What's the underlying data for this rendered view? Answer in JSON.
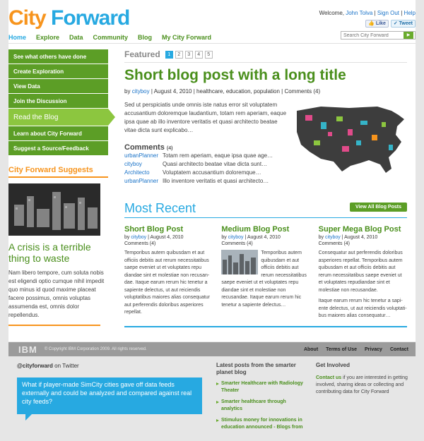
{
  "header": {
    "logo_part1": "City",
    "logo_part2": " Forward",
    "welcome": "Welcome,",
    "user": "John Tolva",
    "sign_out": "Sign Out",
    "help": "Help",
    "like": "Like",
    "tweet": "Tweet",
    "search_placeholder": "Search City Forward"
  },
  "nav": [
    "Home",
    "Explore",
    "Data",
    "Community",
    "Blog",
    "My City Forward"
  ],
  "sidebar": {
    "items": [
      "See what others have done",
      "Create Exploration",
      "View Data",
      "Join the Discussion",
      "Read the Blog",
      "Learn about City Forward",
      "Suggest a Source/Feedback"
    ],
    "suggests_heading": "City Forward Suggests",
    "crisis_title": "A crisis is a terrible thing to waste",
    "suggest_text": "Nam libero tempore, cum soluta nobis est eligendi optio cumque nihil impedit quo minus id quod maxime placeat facere possimus, omnis voluptas assumenda est, omnis dolor repellendus."
  },
  "featured": {
    "label": "Featured",
    "pages": [
      "1",
      "2",
      "3",
      "4",
      "5"
    ],
    "title": "Short blog post with a long title",
    "by": "by",
    "author": "cityboy",
    "date": "August 4, 2010",
    "tags": "healthcare, education, population",
    "comments_link": "Comments (4)",
    "excerpt": "Sed ut perspiciatis unde omnis iste natus error sit voluptatem accusantium doloremque laudantium, totam rem aperiam, eaque ipsa quae ab illo inventore veritatis et quasi architecto beatae vitae dicta sunt explicabo…",
    "comments_heading": "Comments",
    "comments_count": "(4)",
    "comments": [
      {
        "user": "urbanPlanner",
        "text": "Totam rem aperiam, eaque ipsa quae age…"
      },
      {
        "user": "cityboy",
        "text": "Quasi architecto beatae vitae dicta sunt…"
      },
      {
        "user": "Architecto",
        "text": "Voluptatem accusantium doloremque…"
      },
      {
        "user": "urbanPlanner",
        "text": "Illo inventore veritatis et quasi architecto…"
      }
    ]
  },
  "recent": {
    "heading": "Most Recent",
    "button": "View All Blog Posts",
    "posts": [
      {
        "title": "Short Blog Post",
        "by": "by",
        "author": "cityboy",
        "date": "August 4, 2010",
        "comments": "Comments (4)",
        "body": "Temporibus autem quibusdam et aut officiis debitis aut rerum necessitatibus saepe eveniet ut et voluptates repu diandae sint et molestiae non recusan-dae. Itaque earum rerum hic tenetur a sapiente delectus, ut aut reiciendis voluptatibus maiores alias consequatur aut perferendis doloribus asperiores repellat."
      },
      {
        "title": "Medium Blog Post",
        "by": "by",
        "author": "cityboy",
        "date": "August 4, 2010",
        "comments": "Comments (4)",
        "body": "Temporibus autem quibusdam et aut officiis debitis aut rerum necessitatibus saepe eveniet ut et voluptates repu diandae sint et molestiae non recusandae. Itaque earum rerum hic tenetur a sapiente delectus…"
      },
      {
        "title": "Super Mega Blog Post",
        "by": "by",
        "author": "cityboy",
        "date": "August 4, 2010",
        "comments": "Comments (4)",
        "body": "Consequatur aut perferendis doloribus asperiores repellat. Temporibus autem quibusdam et aut officiis debitis aut rerum necessitatibus saepe eveniet ut et voluptates repudiandae sint et molestiae non recusandae.",
        "body2": "Itaque earum rerum hic tenetur a sapi-ente delectus, ut aut reiciendis voluptati-bus maiores alias consequatur…"
      }
    ]
  },
  "footer": {
    "ibm": "IBM",
    "copyright": "© Copyright IBM Corporation 2009. All rights reserved.",
    "links": [
      "About",
      "Terms of Use",
      "Privacy",
      "Contact"
    ],
    "twitter_handle": "@cityforward",
    "twitter_suffix": " on Twitter",
    "tweet_text": "What if player-made SimCity cities gave off data feeds externally and could be analyzed and compared against real city feeds?",
    "latest_heading": "Latest posts from the smarter planet blog",
    "latest_items": [
      "Smarter Healthcare with Radiology Theater",
      "Smarter healthcare through analytics",
      "Stimulus money for innovations in education announced - Blogs from"
    ],
    "involved_heading": "Get Involved",
    "involved_link": "Contact us",
    "involved_text": " if you are interested in getting involved, sharing ideas or collecting and contributing data for City Forward"
  },
  "colors": {
    "green": "#5c9e26",
    "light_green": "#8cc63f",
    "blue": "#27a9e1",
    "orange": "#f7941d"
  }
}
